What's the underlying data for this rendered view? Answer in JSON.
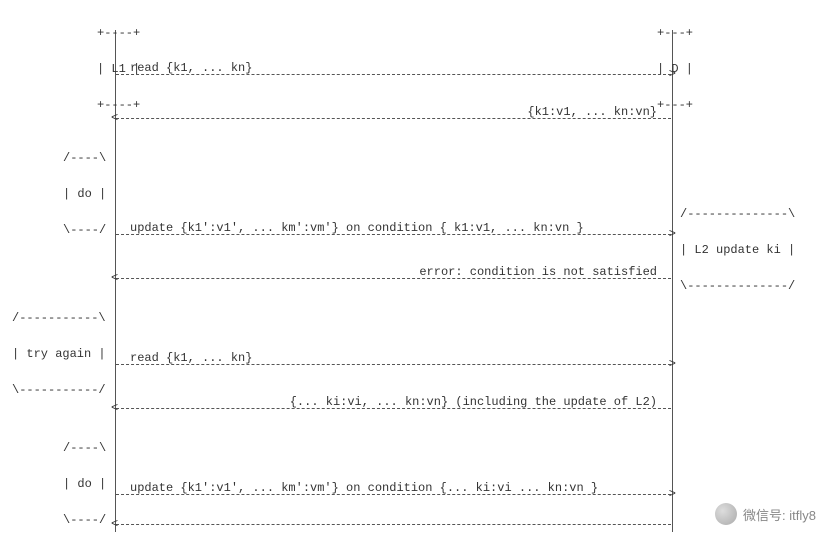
{
  "participants": {
    "L1": {
      "label": "L1",
      "box_top": "+----+",
      "box_mid": "| L1 |",
      "box_bot": "+----+"
    },
    "D": {
      "label": "D",
      "box_top": "+---+",
      "box_mid": "| D |",
      "box_bot": "+---+"
    }
  },
  "messages": [
    {
      "id": "m1",
      "text": "read {k1, ... kn}",
      "dir": "right",
      "align": "left"
    },
    {
      "id": "m2",
      "text": "{k1:v1, ... kn:vn}",
      "dir": "left",
      "align": "right"
    },
    {
      "id": "m3",
      "text": "update {k1':v1', ... km':vm'} on condition { k1:v1, ... kn:vn }",
      "dir": "right",
      "align": "left"
    },
    {
      "id": "m4",
      "text": "error: condition is not satisfied",
      "dir": "left",
      "align": "right"
    },
    {
      "id": "m5",
      "text": "read {k1, ... kn}",
      "dir": "right",
      "align": "left"
    },
    {
      "id": "m6",
      "text": "{... ki:vi, ... kn:vn} (including the update of L2)",
      "dir": "left",
      "align": "right"
    },
    {
      "id": "m7",
      "text": "update {k1':v1', ... km':vm'} on condition {... ki:vi ... kn:vn }",
      "dir": "right",
      "align": "left"
    },
    {
      "id": "m8",
      "text": "",
      "dir": "left",
      "align": "right"
    }
  ],
  "notes": {
    "do1": {
      "line1": "/----\\",
      "line2": "| do |",
      "line3": "\\----/"
    },
    "do2": {
      "line1": "/----\\",
      "line2": "| do |",
      "line3": "\\----/"
    },
    "try_again": {
      "line1": "/-----------\\",
      "line2": "| try again |",
      "line3": "\\-----------/"
    },
    "l2_update": {
      "line1": "/--------------\\",
      "line2": "| L2 update ki |",
      "line3": "\\--------------/"
    }
  },
  "watermark": {
    "label": "微信号: itfly8"
  }
}
